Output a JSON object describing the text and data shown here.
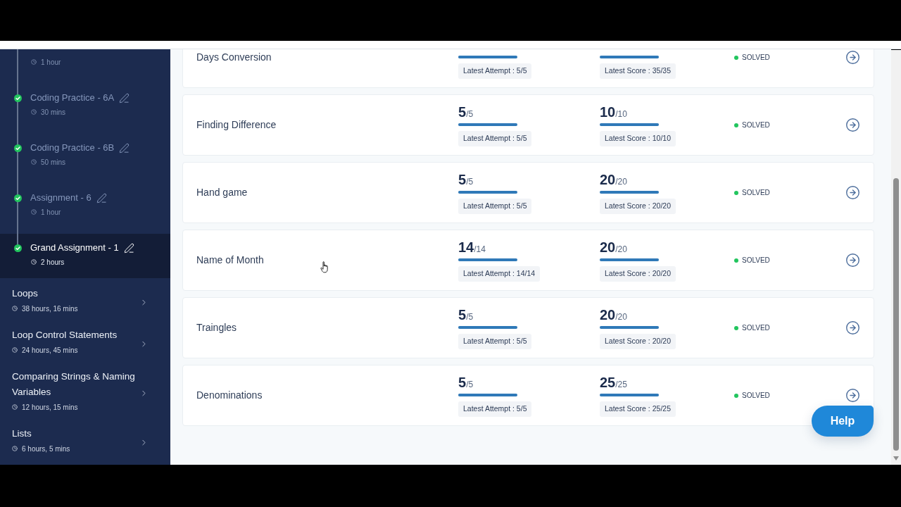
{
  "sidebar": {
    "lessons": [
      {
        "duration": "1 hour",
        "selected": false
      },
      {
        "title": "Coding Practice - 6A",
        "duration": "30 mins",
        "completed": true,
        "selected": false
      },
      {
        "title": "Coding Practice - 6B",
        "duration": "50 mins",
        "completed": true,
        "selected": false
      },
      {
        "title": "Assignment - 6",
        "duration": "1 hour",
        "completed": true,
        "selected": false
      },
      {
        "title": "Grand Assignment - 1",
        "duration": "2 hours",
        "completed": true,
        "selected": true
      }
    ],
    "modules": [
      {
        "title": "Loops",
        "duration": "38 hours, 16 mins",
        "expanded": false
      },
      {
        "title": "Loop Control Statements",
        "duration": "24 hours, 45 mins",
        "expanded": false
      },
      {
        "title": "Comparing Strings & Naming Variables",
        "duration": "12 hours, 15 mins",
        "expanded": false
      },
      {
        "title": "Lists",
        "duration": "6 hours, 5 mins",
        "expanded": false
      }
    ]
  },
  "problems": [
    {
      "name": "Days Conversion",
      "attempts": {
        "level": 1,
        "latest": "Latest Attempt : 5/5"
      },
      "score": {
        "level": 1,
        "latest": "Latest Score : 35/35"
      },
      "status": "SOLVED"
    },
    {
      "name": "Finding Difference",
      "attempts": {
        "value": "5",
        "total": "/5",
        "level": 1,
        "latest": "Latest Attempt : 5/5"
      },
      "score": {
        "value": "10",
        "total": "/10",
        "level": 1,
        "latest": "Latest Score : 10/10"
      },
      "status": "SOLVED"
    },
    {
      "name": "Hand game",
      "attempts": {
        "value": "5",
        "total": "/5",
        "level": 1,
        "latest": "Latest Attempt : 5/5"
      },
      "score": {
        "value": "20",
        "total": "/20",
        "level": 1,
        "latest": "Latest Score : 20/20"
      },
      "status": "SOLVED"
    },
    {
      "name": "Name of Month",
      "attempts": {
        "value": "14",
        "total": "/14",
        "level": 1,
        "latest": "Latest Attempt : 14/14"
      },
      "score": {
        "value": "20",
        "total": "/20",
        "level": 1,
        "latest": "Latest Score : 20/20"
      },
      "status": "SOLVED"
    },
    {
      "name": "Traingles",
      "attempts": {
        "value": "5",
        "total": "/5",
        "level": 1,
        "latest": "Latest Attempt : 5/5"
      },
      "score": {
        "value": "20",
        "total": "/20",
        "level": 1,
        "latest": "Latest Score : 20/20"
      },
      "status": "SOLVED"
    },
    {
      "name": "Denominations",
      "attempts": {
        "value": "5",
        "total": "/5",
        "level": 1,
        "latest": "Latest Attempt : 5/5"
      },
      "score": {
        "value": "25",
        "total": "/25",
        "level": 1,
        "latest": "Latest Score : 25/25"
      },
      "status": "SOLVED"
    }
  ],
  "help_button": "Help"
}
